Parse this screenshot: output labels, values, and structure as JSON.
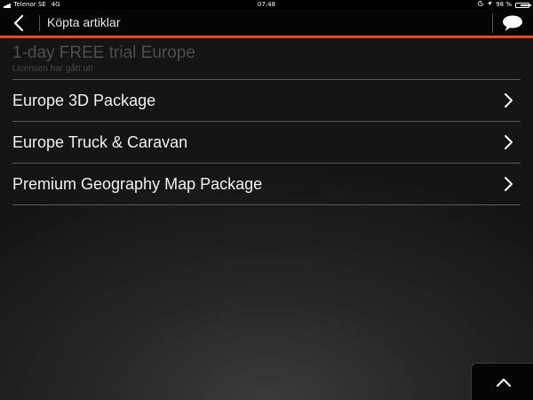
{
  "status_bar": {
    "carrier": "Telenor SE",
    "network": "4G",
    "time": "07:48",
    "battery_text": "98 %",
    "battery_level": 0.98,
    "icons": [
      "signal-bars-icon",
      "moon-icon",
      "location-arrow-icon",
      "battery-icon"
    ]
  },
  "nav": {
    "title": "Köpta artiklar",
    "back_icon": "chevron-left-icon",
    "chat_icon": "speech-bubble-icon"
  },
  "colors": {
    "accent": "#e8491c",
    "background": "#1e1e1e",
    "row_text": "#f0f0f0",
    "disabled_text": "#4e4e4e"
  },
  "trial": {
    "title": "1-day FREE trial Europe",
    "subtitle": "Licensen har gått ut!"
  },
  "items": [
    {
      "label": "Europe 3D Package"
    },
    {
      "label": "Europe Truck & Caravan"
    },
    {
      "label": "Premium Geography Map Package"
    }
  ],
  "scroll_top": {
    "icon": "chevron-up-icon"
  }
}
